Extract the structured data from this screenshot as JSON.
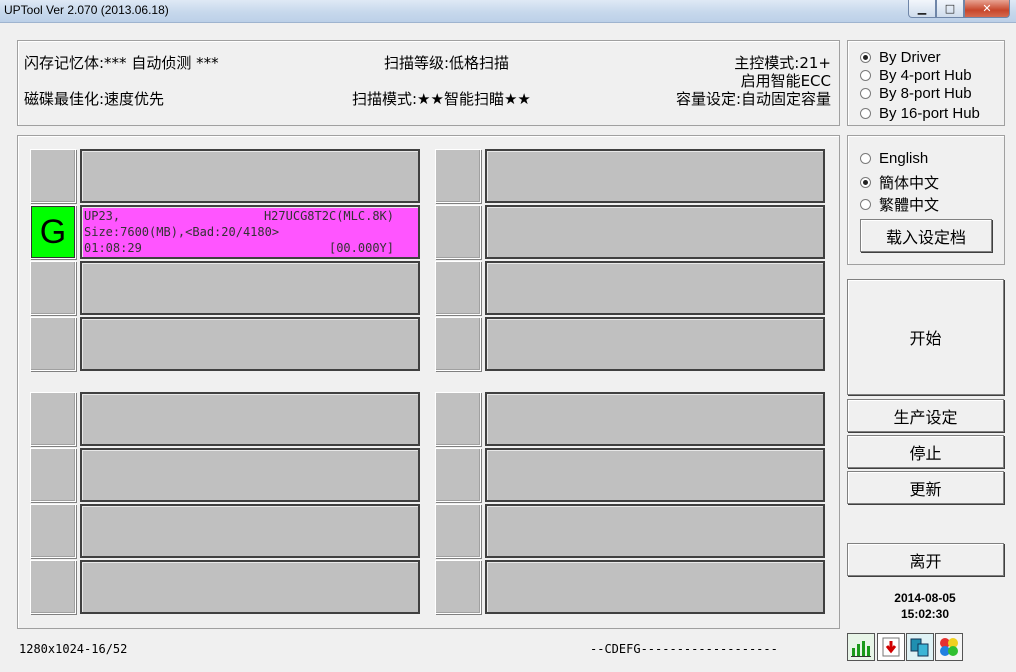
{
  "window": {
    "title": "UPTool Ver 2.070 (2013.06.18)"
  },
  "info": {
    "flash": "闪存记忆体:*** 自动侦测 ***",
    "scan_level": "扫描等级:低格扫描",
    "controller_mode": "主控模式:21+",
    "ecc": "启用智能ECC",
    "disk_opt": "磁碟最佳化:速度优先",
    "scan_mode": "扫描模式:★★智能扫瞄★★",
    "capacity": "容量设定:自动固定容量"
  },
  "driver_options": [
    {
      "label": "By Driver",
      "selected": true
    },
    {
      "label": "By 4-port Hub",
      "selected": false
    },
    {
      "label": "By 8-port Hub",
      "selected": false
    },
    {
      "label": "By 16-port Hub",
      "selected": false
    }
  ],
  "language_options": [
    {
      "label": "English",
      "selected": false
    },
    {
      "label": "簡体中文",
      "selected": true
    },
    {
      "label": "繁體中文",
      "selected": false
    }
  ],
  "buttons": {
    "load_config": "载入设定档",
    "start": "开始",
    "production_settings": "生产设定",
    "stop": "停止",
    "update": "更新",
    "exit": "离开"
  },
  "active_port": {
    "status_letter": "G",
    "name": "UP23,",
    "flash_id": "H27UCG8T2C(MLC.8K)",
    "size": "Size:7600(MB),<Bad:20/4180>",
    "elapsed": "01:08:29",
    "progress": "[00.000Y]",
    "color": "#ff55ff"
  },
  "datetime": {
    "date": "2014-08-05",
    "time": "15:02:30"
  },
  "status": {
    "resolution": "1280x1024-16/52",
    "drives": "--CDEFG-------------------"
  }
}
